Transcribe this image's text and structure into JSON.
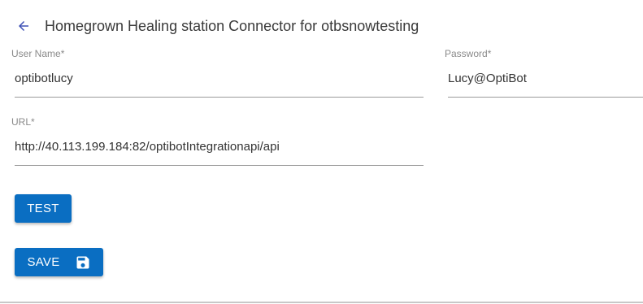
{
  "header": {
    "back_icon": "arrow-left-icon",
    "title": "Homegrown Healing station Connector for otbsnowtesting"
  },
  "form": {
    "username": {
      "label": "User Name",
      "required_mark": "*",
      "value": "optibotlucy"
    },
    "password": {
      "label": "Password",
      "required_mark": "*",
      "value": "Lucy@OptiBot"
    },
    "url": {
      "label": "URL",
      "required_mark": "*",
      "value": "http://40.113.199.184:82/optibotIntegrationapi/api"
    }
  },
  "actions": {
    "test_label": "TEST",
    "save_label": "SAVE",
    "save_icon": "floppy-disk-icon"
  },
  "colors": {
    "accent": "#0a6ec2",
    "back_arrow": "#3f51b5"
  }
}
